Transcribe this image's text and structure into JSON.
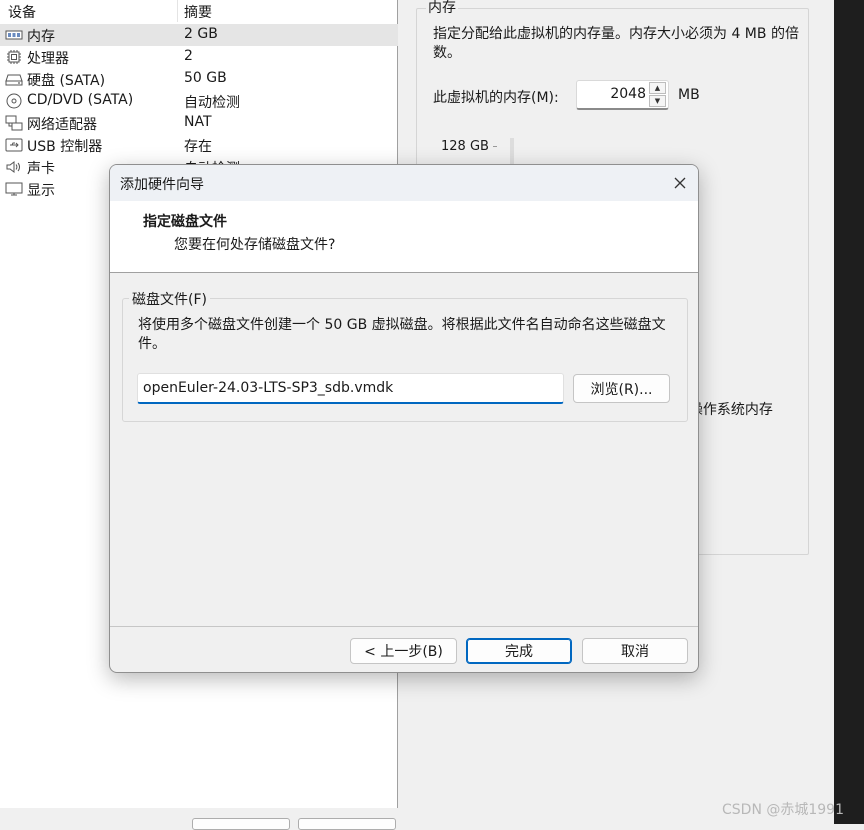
{
  "device_list": {
    "header": {
      "device": "设备",
      "summary": "摘要"
    },
    "rows": [
      {
        "name": "内存",
        "summary": "2 GB",
        "icon": "memory-icon"
      },
      {
        "name": "处理器",
        "summary": "2",
        "icon": "processor-icon"
      },
      {
        "name": "硬盘 (SATA)",
        "summary": "50 GB",
        "icon": "hard-disk-icon"
      },
      {
        "name": "CD/DVD (SATA)",
        "summary": "自动检测",
        "icon": "cd-dvd-icon"
      },
      {
        "name": "网络适配器",
        "summary": "NAT",
        "icon": "network-adapter-icon"
      },
      {
        "name": "USB 控制器",
        "summary": "存在",
        "icon": "usb-icon"
      },
      {
        "name": "声卡",
        "summary": "自动检测",
        "icon": "sound-card-icon"
      },
      {
        "name": "显示",
        "summary": "",
        "icon": "display-icon"
      }
    ],
    "selected_index": 0
  },
  "memory_panel": {
    "legend": "内存",
    "description": "指定分配给此虚拟机的内存量。内存大小必须为 4 MB 的倍数。",
    "memory_label": "此虚拟机的内存(M):",
    "memory_value": "2048",
    "unit": "MB",
    "slider_top_label": "128 GB",
    "partial_text": "l操作系统内存"
  },
  "dialog": {
    "title": "添加硬件向导",
    "header_title": "指定磁盘文件",
    "header_subtitle": "您要在何处存储磁盘文件?",
    "file_group_label": "磁盘文件(F)",
    "file_description": "将使用多个磁盘文件创建一个 50 GB 虚拟磁盘。将根据此文件名自动命名这些磁盘文件。",
    "file_name": "openEuler-24.03-LTS-SP3_sdb.vmdk",
    "browse_label": "浏览(R)...",
    "back_label": "< 上一步(B)",
    "finish_label": "完成",
    "cancel_label": "取消"
  },
  "watermark": "CSDN @赤城1991",
  "colors": {
    "accent": "#0067c0",
    "selected_row": "#e5e5e5",
    "dialog_title_bg": "#eef1f5"
  }
}
